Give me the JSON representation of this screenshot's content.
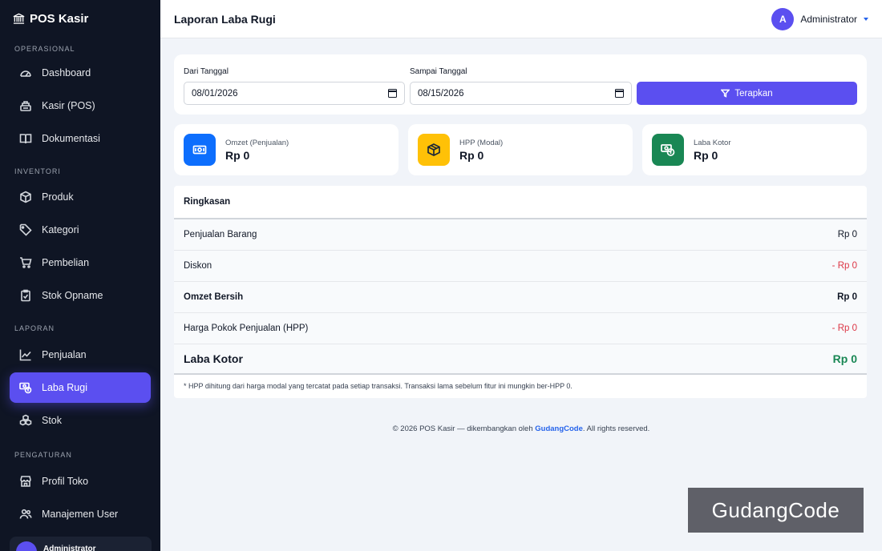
{
  "app": {
    "brand": "POS Kasir"
  },
  "sidebar": {
    "sections": [
      {
        "title": "OPERASIONAL",
        "items": [
          {
            "label": "Dashboard",
            "icon": "gauge-icon"
          },
          {
            "label": "Kasir (POS)",
            "icon": "cash-register-icon"
          },
          {
            "label": "Dokumentasi",
            "icon": "book-icon"
          }
        ]
      },
      {
        "title": "INVENTORI",
        "items": [
          {
            "label": "Produk",
            "icon": "box-icon"
          },
          {
            "label": "Kategori",
            "icon": "tag-icon"
          },
          {
            "label": "Pembelian",
            "icon": "cart-icon"
          }
        ]
      },
      {
        "title": "",
        "items": [
          {
            "label": "Stok Opname",
            "icon": "clipboard-check-icon"
          }
        ]
      },
      {
        "title": "LAPORAN",
        "items": [
          {
            "label": "Penjualan",
            "icon": "line-chart-icon"
          },
          {
            "label": "Laba Rugi",
            "icon": "cash-coin-icon",
            "active": true
          },
          {
            "label": "Stok",
            "icon": "boxes-icon"
          }
        ]
      },
      {
        "title": "PENGATURAN",
        "items": [
          {
            "label": "Profil Toko",
            "icon": "shop-icon"
          },
          {
            "label": "Manajemen User",
            "icon": "people-icon"
          }
        ]
      }
    ],
    "user_name": "Administrator"
  },
  "topbar": {
    "title": "Laporan Laba Rugi",
    "avatar_initial": "A",
    "user_name": "Administrator"
  },
  "filter": {
    "from_label": "Dari Tanggal",
    "from_value": "08/01/2026",
    "to_label": "Sampai Tanggal",
    "to_value": "08/15/2026",
    "apply_label": "Terapkan"
  },
  "stats": [
    {
      "label": "Omzet (Penjualan)",
      "value": "Rp 0",
      "color": "#0d6efd",
      "icon": "cash-icon"
    },
    {
      "label": "HPP (Modal)",
      "value": "Rp 0",
      "color": "#ffc107",
      "icon": "box-icon"
    },
    {
      "label": "Laba Kotor",
      "value": "Rp 0",
      "color": "#198754",
      "icon": "cash-coin-icon"
    }
  ],
  "summary": {
    "title": "Ringkasan",
    "rows": [
      {
        "label": "Penjualan Barang",
        "value": "Rp 0"
      },
      {
        "label": "Diskon",
        "value": "- Rp 0"
      },
      {
        "label": "Omzet Bersih",
        "value": "Rp 0"
      },
      {
        "label": "Harga Pokok Penjualan (HPP)",
        "value": "- Rp 0"
      },
      {
        "label": "Laba Kotor",
        "value": "Rp 0"
      }
    ],
    "note": "* HPP dihitung dari harga modal yang tercatat pada setiap transaksi. Transaksi lama sebelum fitur ini mungkin ber-HPP 0."
  },
  "footer": {
    "prefix": "© 2026 POS Kasir — dikembangkan oleh ",
    "link": "GudangCode",
    "suffix": ". All rights reserved."
  },
  "watermark": "GudangCode"
}
